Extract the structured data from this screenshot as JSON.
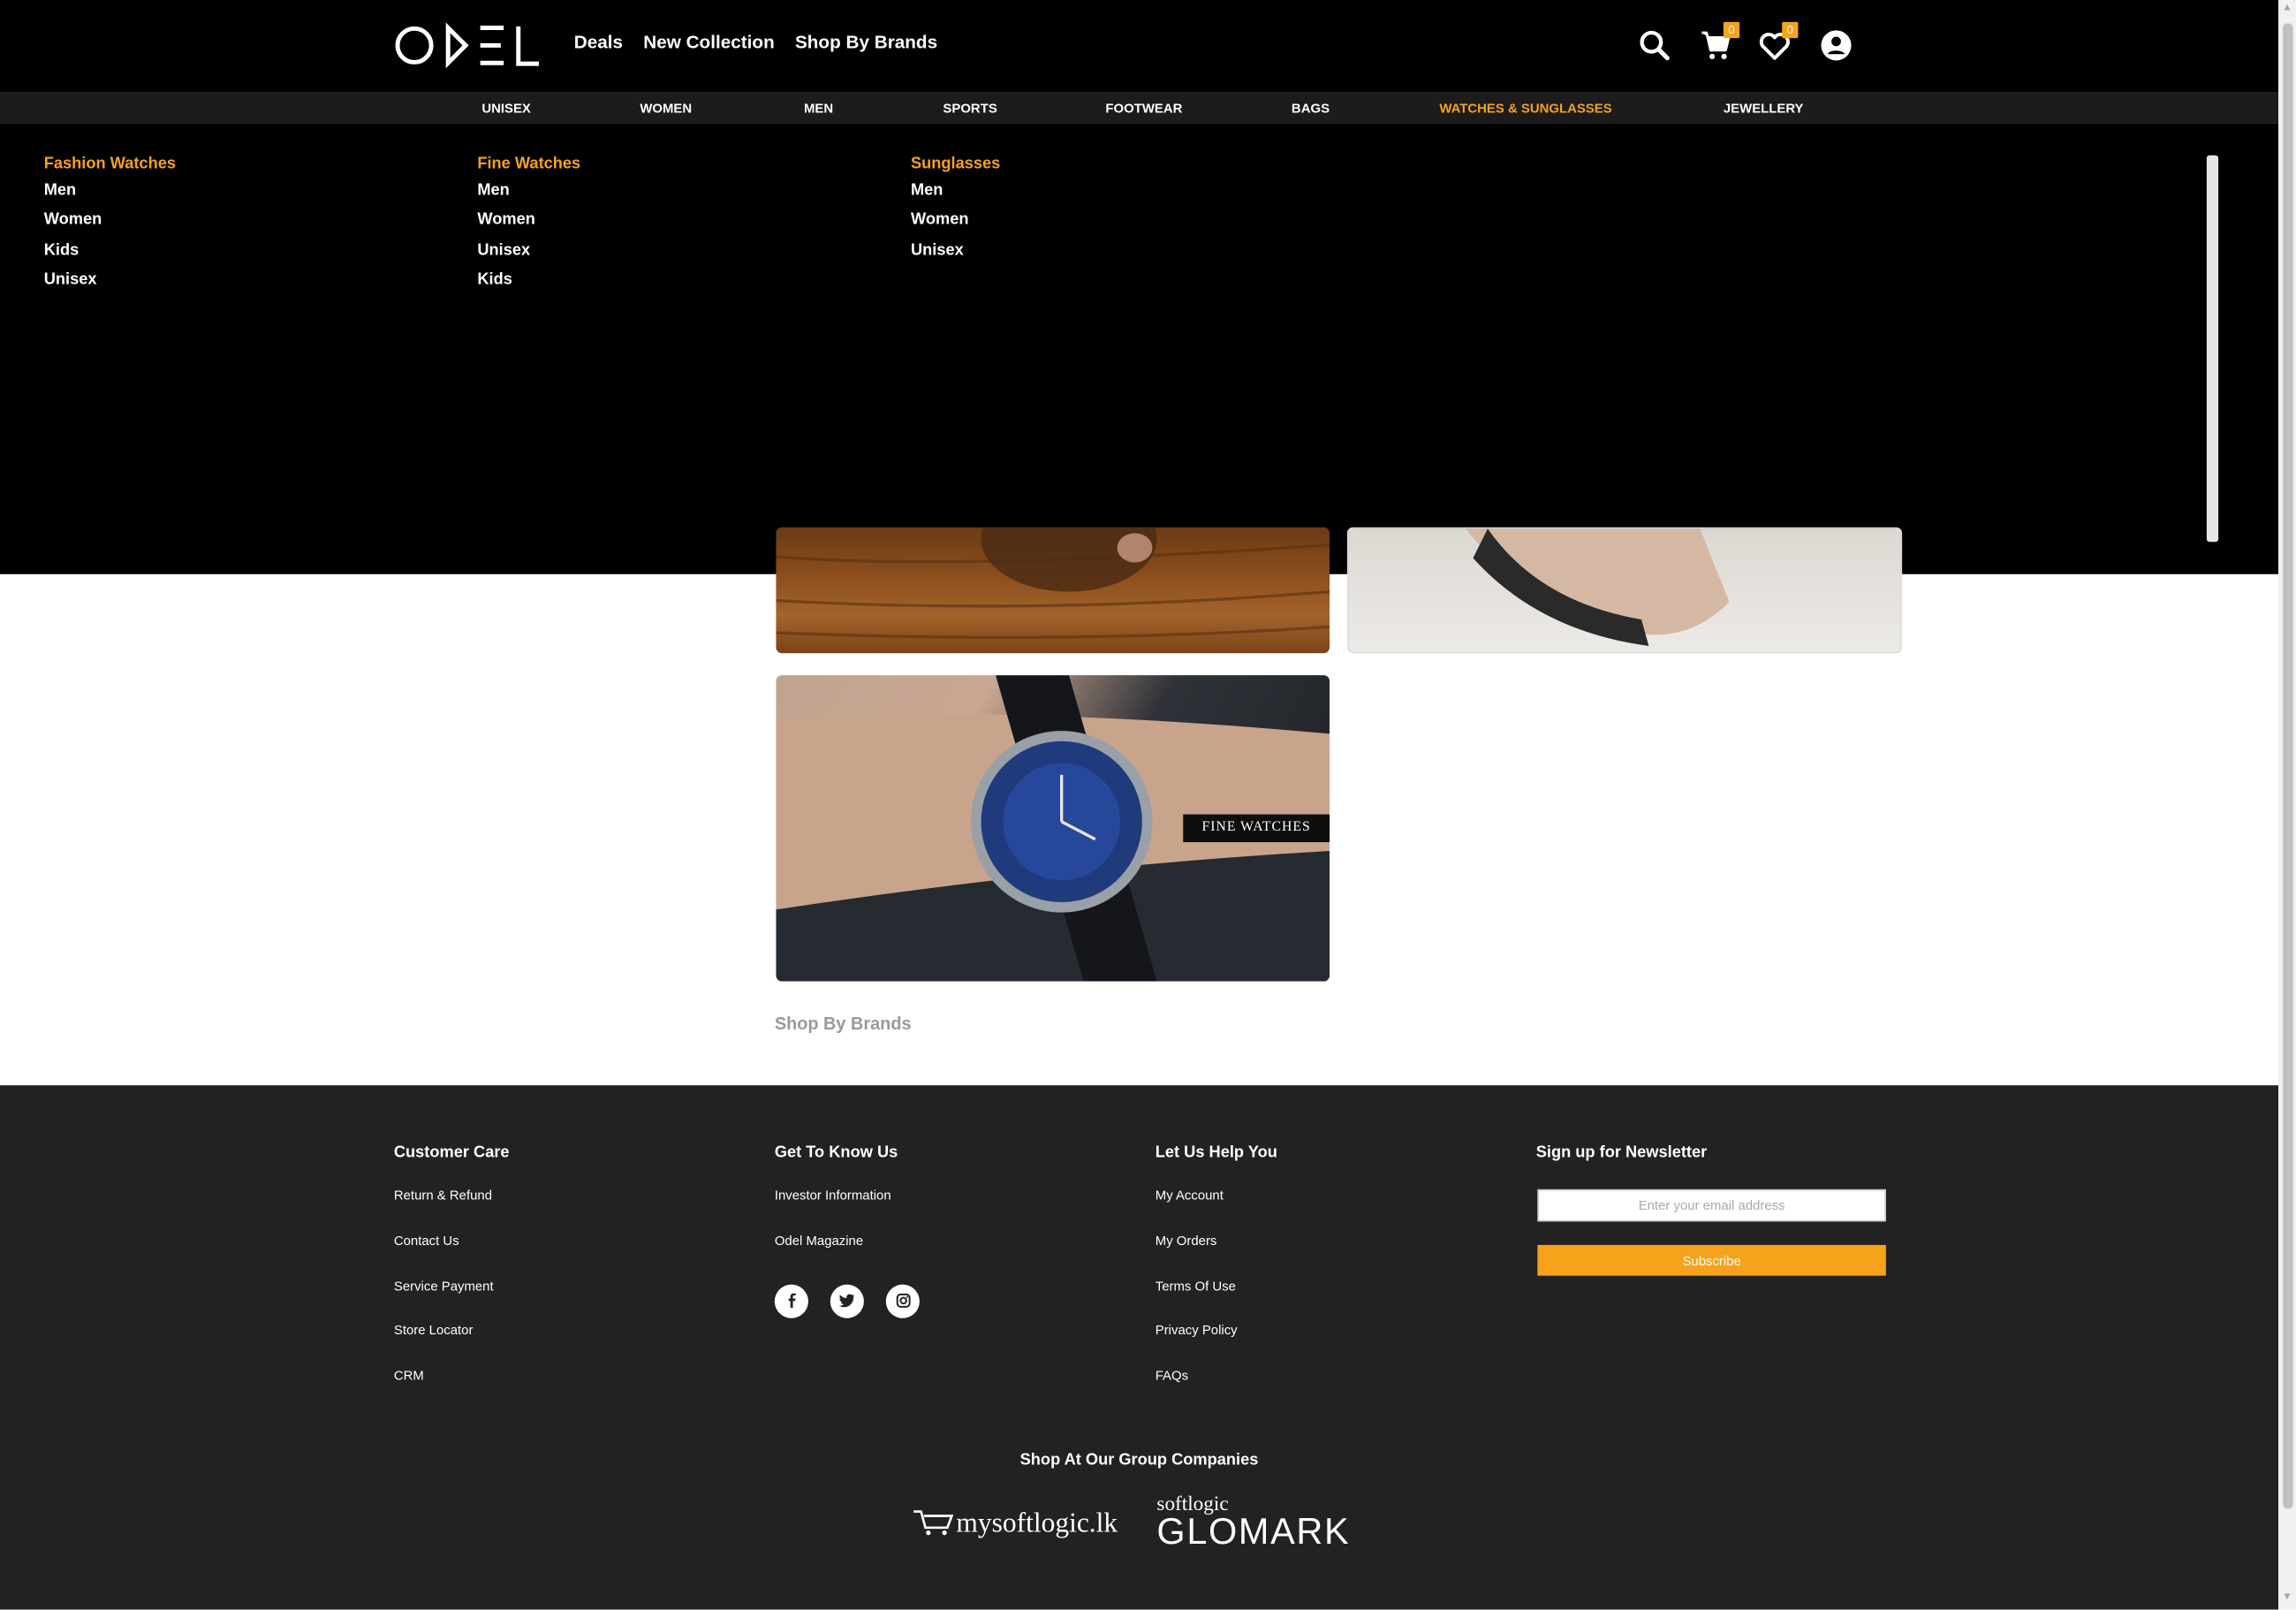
{
  "brand": {
    "logo_text": "ODEL",
    "accent_color": "#f7a21b"
  },
  "top_nav": [
    "Deals",
    "New Collection",
    "Shop By Brands"
  ],
  "header_icons": {
    "search": "search-icon",
    "cart": "cart-icon",
    "wishlist": "heart-icon",
    "account": "user-icon",
    "cart_count": "0",
    "wishlist_count": "0"
  },
  "categories": [
    "UNISEX",
    "WOMEN",
    "MEN",
    "SPORTS",
    "FOOTWEAR",
    "BAGS",
    "WATCHES & SUNGLASSES",
    "JEWELLERY"
  ],
  "active_category": "WATCHES & SUNGLASSES",
  "mega_menu": [
    {
      "title": "Fashion Watches",
      "items": [
        "Men",
        "Women",
        "Kids",
        "Unisex"
      ]
    },
    {
      "title": "Fine Watches",
      "items": [
        "Men",
        "Women",
        "Unisex",
        "Kids"
      ]
    },
    {
      "title": "Sunglasses",
      "items": [
        "Men",
        "Women",
        "Unisex"
      ]
    }
  ],
  "main": {
    "tile_label": "FINE WATCHES",
    "shop_by_brands": "Shop By Brands"
  },
  "footer": {
    "customer_care": {
      "title": "Customer Care",
      "links": [
        "Return & Refund",
        "Contact Us",
        "Service Payment",
        "Store Locator",
        "CRM"
      ]
    },
    "get_to_know": {
      "title": "Get To Know Us",
      "links": [
        "Investor Information",
        "Odel Magazine"
      ]
    },
    "help": {
      "title": "Let Us Help You",
      "links": [
        "My Account",
        "My Orders",
        "Terms Of Use",
        "Privacy Policy",
        "FAQs"
      ]
    },
    "newsletter": {
      "title": "Sign up for Newsletter",
      "placeholder": "Enter your email address",
      "button": "Subscribe"
    },
    "social": [
      "facebook-icon",
      "twitter-icon",
      "instagram-icon"
    ],
    "group_title": "Shop At Our Group Companies",
    "group_logos": {
      "mysoftlogic": "mysoftlogic.lk",
      "glomark_top": "softlogic",
      "glomark": "GLOMARK"
    }
  }
}
